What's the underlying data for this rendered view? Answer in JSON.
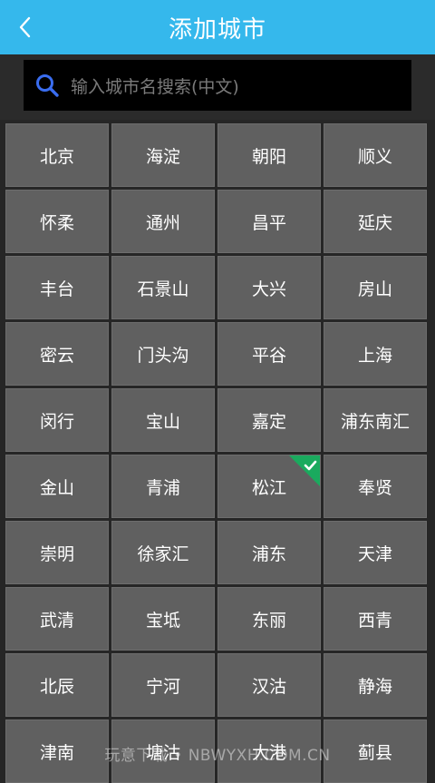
{
  "header": {
    "title": "添加城市",
    "back_icon": "chevron-left-icon"
  },
  "search": {
    "placeholder": "输入城市名搜索(中文)",
    "icon": "search-icon"
  },
  "cities": [
    "北京",
    "海淀",
    "朝阳",
    "顺义",
    "怀柔",
    "通州",
    "昌平",
    "延庆",
    "丰台",
    "石景山",
    "大兴",
    "房山",
    "密云",
    "门头沟",
    "平谷",
    "上海",
    "闵行",
    "宝山",
    "嘉定",
    "浦东南汇",
    "金山",
    "青浦",
    "松江",
    "奉贤",
    "崇明",
    "徐家汇",
    "浦东",
    "天津",
    "武清",
    "宝坻",
    "东丽",
    "西青",
    "北辰",
    "宁河",
    "汉沽",
    "静海",
    "津南",
    "塘沽",
    "大港",
    "蓟县"
  ],
  "selected_city": "松江",
  "watermark": "玩意下载 • NBWYXH.COM.CN",
  "colors": {
    "header": "#35b8ec",
    "cell": "#606060",
    "check": "#1aaa5e",
    "search_icon": "#3a6df0"
  }
}
